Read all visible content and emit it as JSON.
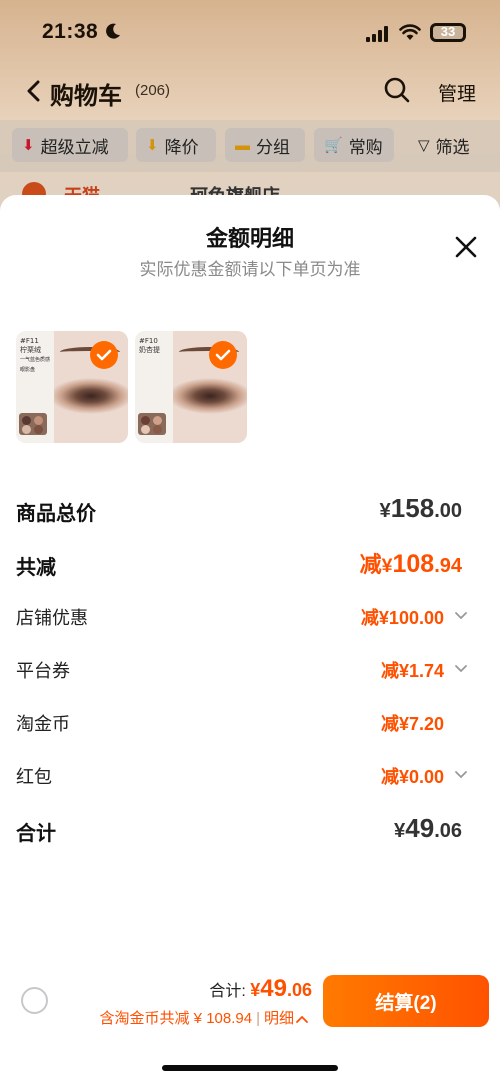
{
  "status_bar": {
    "time": "21:38",
    "battery": "33"
  },
  "nav": {
    "title": "购物车",
    "count": "(206)",
    "manage": "管理"
  },
  "filters": [
    {
      "label": "超级立减",
      "icon": "red-arrow-down-icon"
    },
    {
      "label": "降价",
      "icon": "yellow-arrow-down-icon"
    },
    {
      "label": "分组",
      "icon": "folder-icon"
    },
    {
      "label": "常购",
      "icon": "cart-icon"
    },
    {
      "label": "筛选",
      "icon": "filter-icon"
    }
  ],
  "background_shop": {
    "name_a": "天猫",
    "name_b": "珂色旗舰店"
  },
  "sheet": {
    "title": "金额明细",
    "subtitle": "实际优惠金额请以下单页为准",
    "products": [
      {
        "caption": "#F11\n柠栗绒\n一气蓝色质感眼影盘"
      },
      {
        "caption": "#F10\n奶杏提\n"
      }
    ],
    "rows": [
      {
        "label": "商品总价",
        "yen": "¥",
        "int": "158",
        "dec": ".00"
      },
      {
        "label": "共减",
        "prefix": "减",
        "yen": "¥",
        "int": "108",
        "dec": ".94"
      },
      {
        "label": "店铺优惠",
        "value": "减¥100.00"
      },
      {
        "label": "平台券",
        "value": "减¥1.74"
      },
      {
        "label": "淘金币",
        "value": "减¥7.20"
      },
      {
        "label": "红包",
        "value": "减¥0.00"
      },
      {
        "label": "合计",
        "yen": "¥",
        "int": "49",
        "dec": ".06"
      }
    ]
  },
  "bottom_bar": {
    "total_label": "合计:",
    "total_yen": "¥",
    "total_int": "49",
    "total_dec": ".06",
    "saving_text": "含淘金币共减 ¥ 108.94",
    "detail_label": "明细",
    "checkout_label": "结算(2)"
  },
  "colors": {
    "accent": "#ff5000",
    "check": "#ff6a00"
  }
}
